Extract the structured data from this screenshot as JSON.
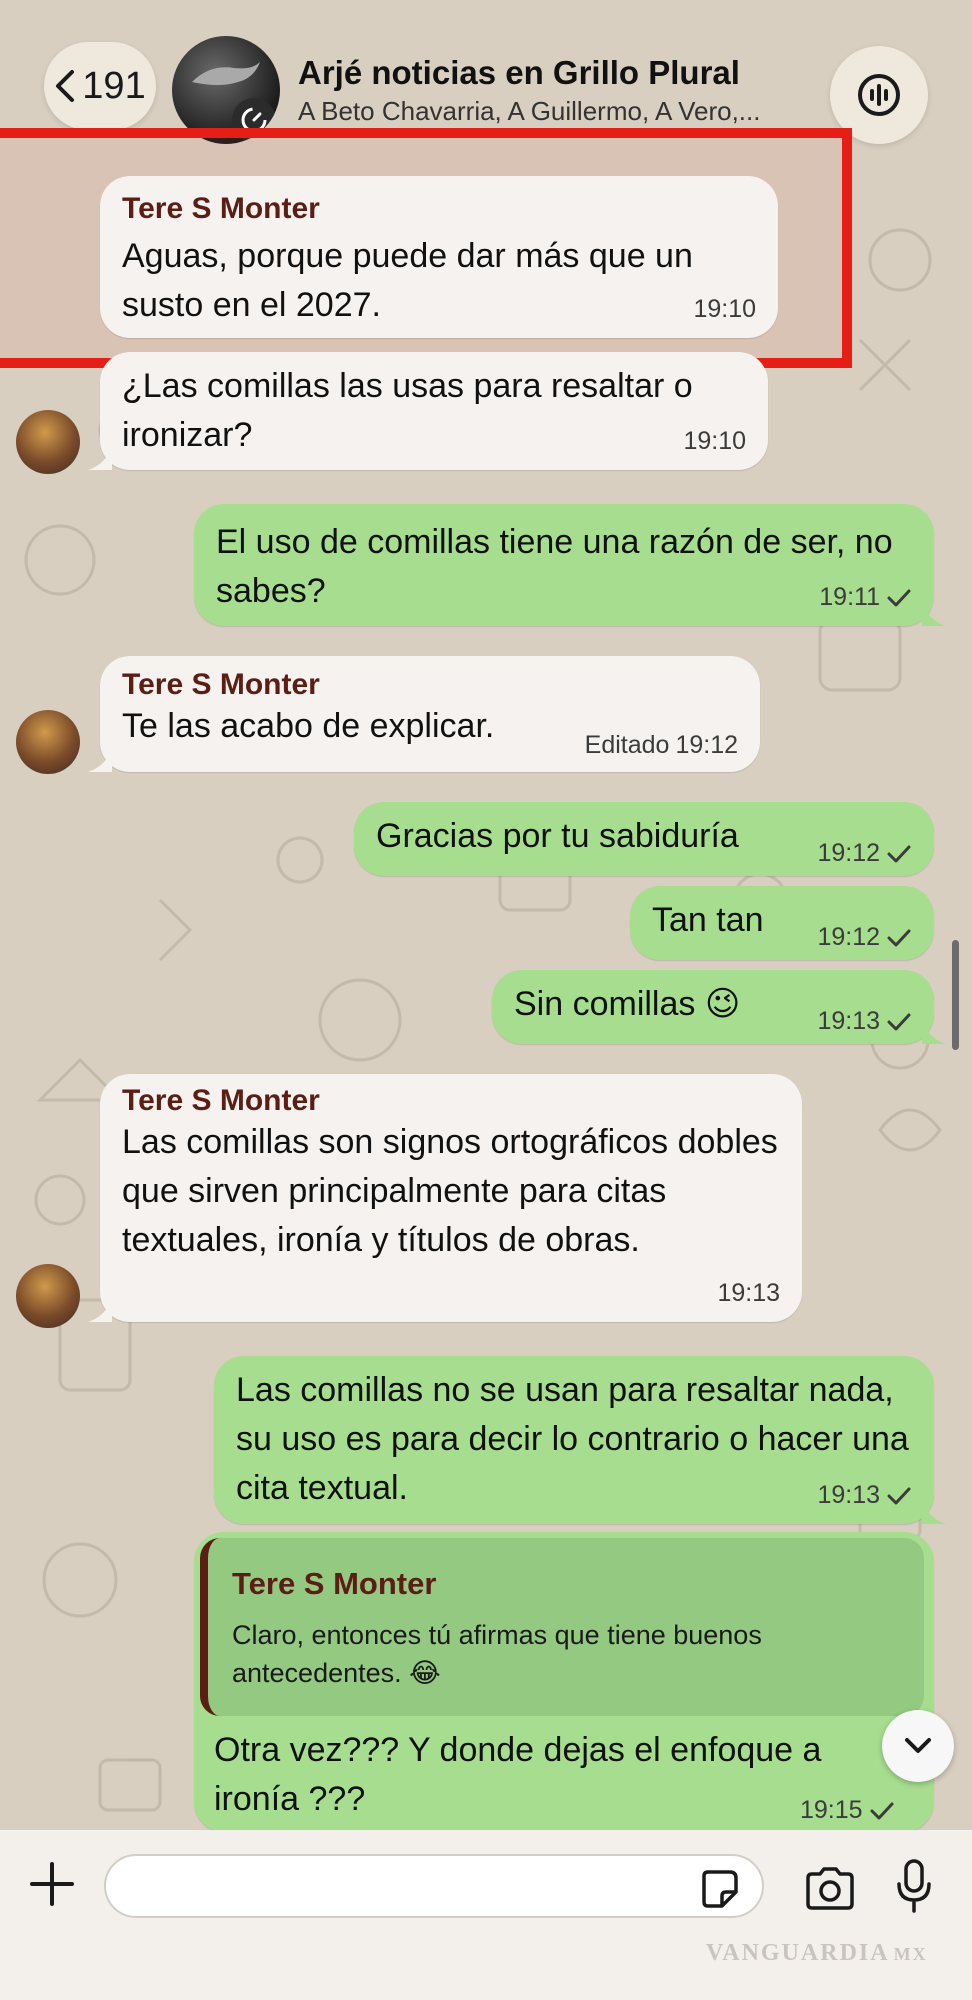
{
  "header": {
    "back_count": "191",
    "group_name": "Arjé noticias en Grillo Plural",
    "members": "A Beto Chavarria, A Guillermo, A Vero,..."
  },
  "messages": [
    {
      "sender": "Tere S Monter",
      "text": "Aguas, porque puede dar más que un susto en el 2027.",
      "time": "19:10"
    },
    {
      "text": "¿Las comillas las usas para resaltar o ironizar?",
      "time": "19:10"
    },
    {
      "text": "El uso de comillas tiene una razón de ser, no sabes?",
      "time": "19:11"
    },
    {
      "sender": "Tere S Monter",
      "text": "Te las acabo de explicar.",
      "edited": "Editado",
      "time": "19:12"
    },
    {
      "text": "Gracias por tu sabiduría",
      "time": "19:12"
    },
    {
      "text": "Tan tan",
      "time": "19:12"
    },
    {
      "text": "Sin comillas 😉",
      "time": "19:13"
    },
    {
      "sender": "Tere S Monter",
      "text": "Las comillas son signos ortográficos dobles que sirven principalmente para citas textuales, ironía y títulos de obras.",
      "time": "19:13"
    },
    {
      "text": "Las comillas no se usan para resaltar nada, su uso es para decir lo contrario o hacer una cita textual.",
      "time": "19:13"
    },
    {
      "quote_sender": "Tere S Monter",
      "quote_text": "Claro, entonces tú afirmas que tiene buenos antecedentes. 😂",
      "text": "Otra vez??? Y donde dejas el enfoque a ironía ???",
      "time": "19:15"
    }
  ],
  "watermark": "VANGUARDIA",
  "watermark_suffix": "MX",
  "colors": {
    "incoming": "#f5f2ef",
    "outgoing": "#a7dd8f",
    "highlight": "#e51f16",
    "sender": "#5a1e14"
  }
}
